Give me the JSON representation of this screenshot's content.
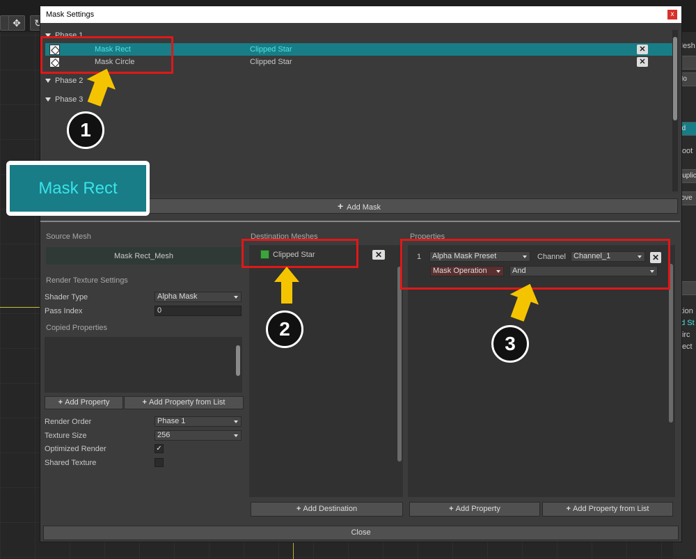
{
  "window": {
    "title": "Mask Settings",
    "close_glyph": "x"
  },
  "phases": [
    {
      "label": "Phase 1"
    },
    {
      "label": "Phase 2"
    },
    {
      "label": "Phase 3"
    }
  ],
  "masks": [
    {
      "name": "Mask Rect",
      "dest": "Clipped Star",
      "selected": true
    },
    {
      "name": "Mask Circle",
      "dest": "Clipped Star",
      "selected": false
    }
  ],
  "add_mask_label": "Add Mask",
  "source": {
    "title": "Source Mesh",
    "mesh": "Mask Rect_Mesh",
    "rts_title": "Render Texture Settings",
    "shader_type_label": "Shader Type",
    "shader_type_value": "Alpha Mask",
    "pass_index_label": "Pass Index",
    "pass_index_value": "0",
    "copied_label": "Copied Properties",
    "add_property": "Add Property",
    "add_property_list": "Add Property from List",
    "render_order_label": "Render Order",
    "render_order_value": "Phase 1",
    "texture_size_label": "Texture Size",
    "texture_size_value": "256",
    "optimized_label": "Optimized Render",
    "optimized_checked": true,
    "shared_label": "Shared Texture",
    "shared_checked": false
  },
  "destination": {
    "title": "Destination Meshes",
    "item": "Clipped Star",
    "add_label": "Add Destination"
  },
  "properties": {
    "title": "Properties",
    "index": "1",
    "preset": "Alpha Mask Preset",
    "channel_label": "Channel",
    "channel_value": "Channel_1",
    "op_label": "Mask Operation",
    "op_value": "And",
    "add_property": "Add Property",
    "add_property_list": "Add Property from List"
  },
  "close_label": "Close",
  "zoom_callout": "Mask Rect",
  "callouts": [
    "1",
    "2",
    "3"
  ],
  "background": {
    "right_items": [
      "Mesh",
      "Mo",
      "Ed",
      "Root",
      "Duplic",
      "nove",
      "ation",
      "ed St",
      "Circ",
      "Rect"
    ]
  },
  "colors": {
    "selection": "#187d86",
    "annotation_red": "#e01818",
    "arrow_yellow": "#f5c400"
  }
}
